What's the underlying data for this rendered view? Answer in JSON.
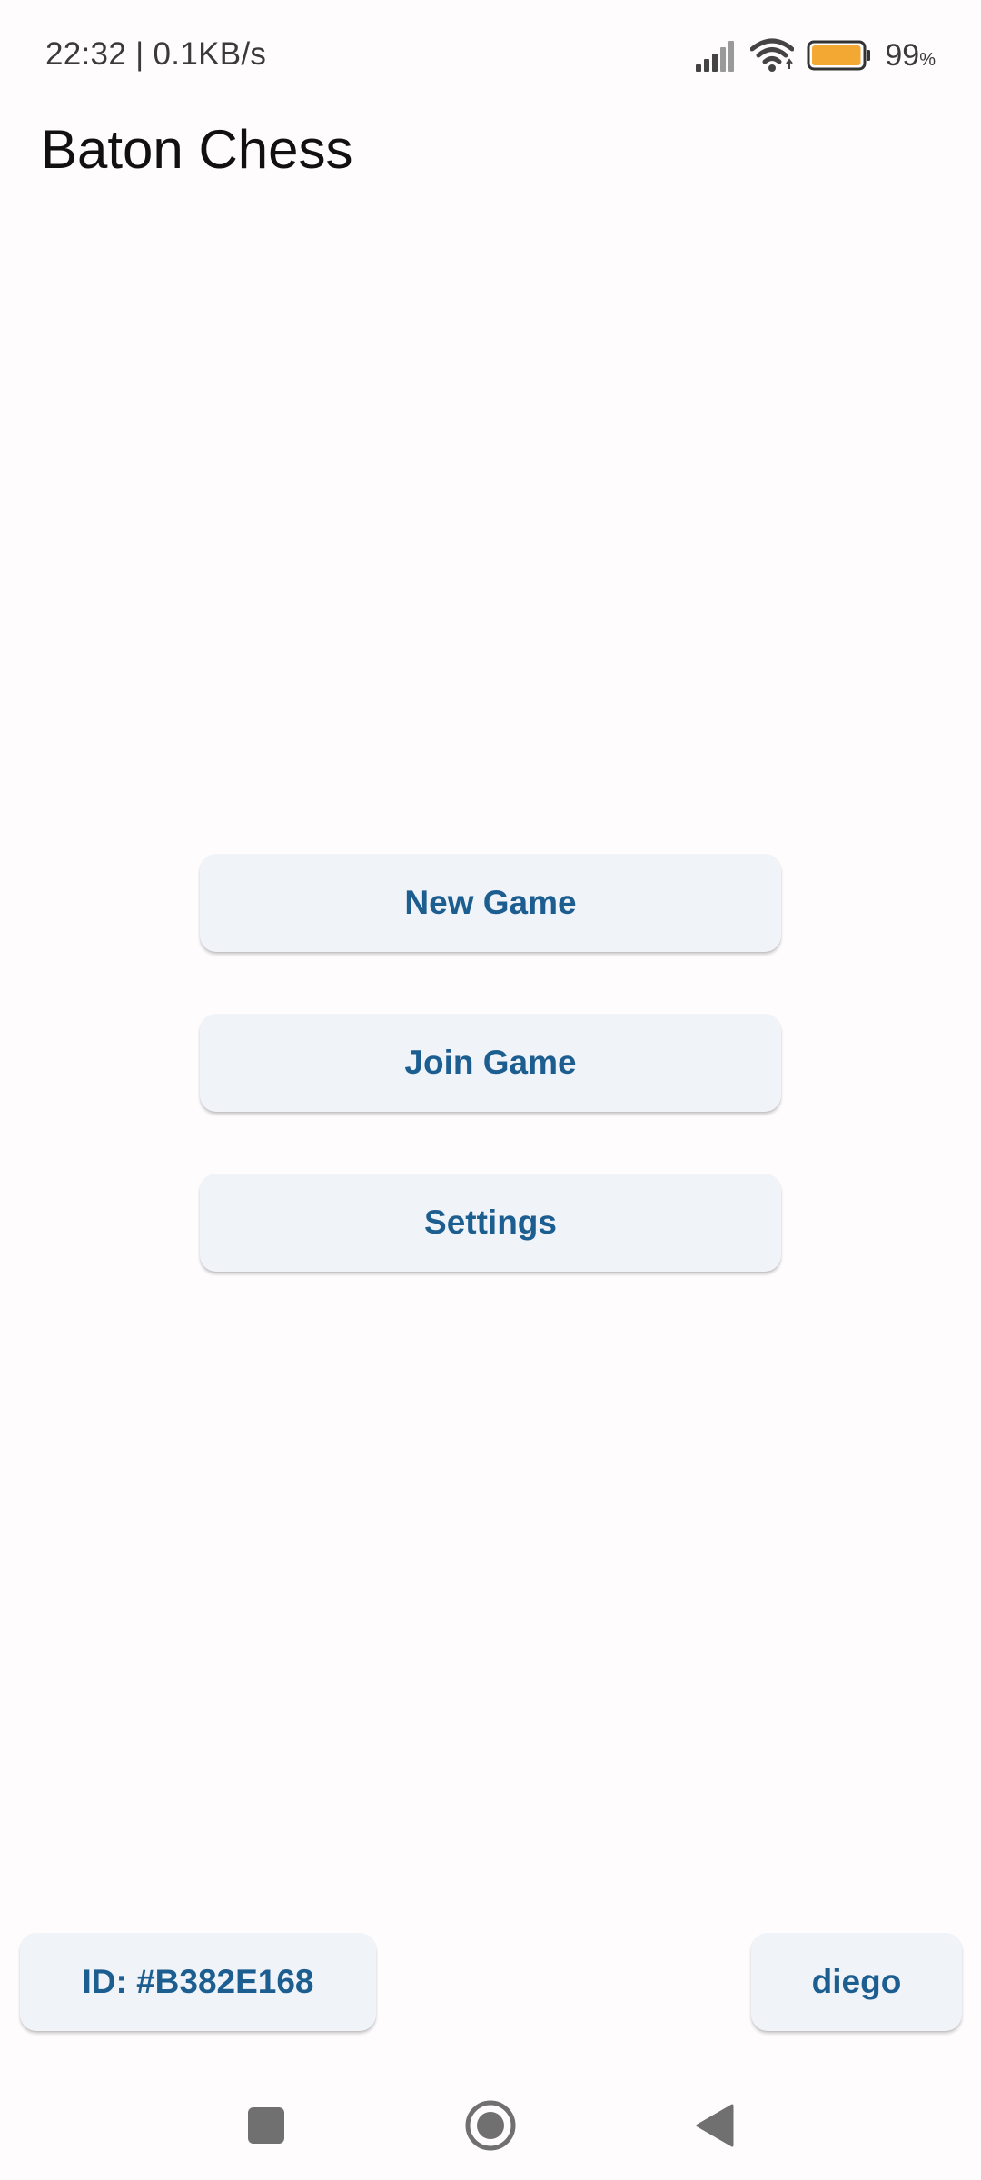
{
  "status_bar": {
    "left_text": "22:32 | 0.1KB/s",
    "battery_percent": "99",
    "battery_unit": "%",
    "battery_level": 0.99,
    "battery_color": "#f2a833",
    "icons": [
      "signal-icon",
      "wifi-icon",
      "battery-icon"
    ]
  },
  "app": {
    "title": "Baton Chess"
  },
  "menu": {
    "new_game": "New Game",
    "join_game": "Join Game",
    "settings": "Settings"
  },
  "footer": {
    "id_label": "ID: #B382E168",
    "username": "diego"
  },
  "nav": {
    "icons": [
      "recent-apps-icon",
      "home-icon",
      "back-icon"
    ]
  },
  "colors": {
    "accent": "#1d5e90",
    "button_bg": "#f0f3f8",
    "background": "#fefcfd"
  }
}
